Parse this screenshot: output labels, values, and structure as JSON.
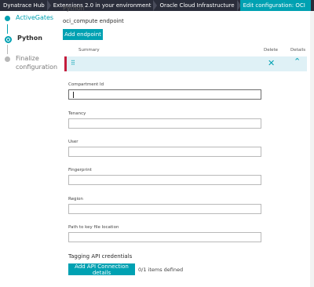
{
  "breadcrumb": [
    {
      "label": "Dynatrace Hub"
    },
    {
      "label": "Extensions 2.0 in your environment"
    },
    {
      "label": "Oracle Cloud Infrastructure"
    },
    {
      "label": "Edit configuration: OCI"
    }
  ],
  "stepper": {
    "steps": [
      {
        "label": "ActiveGates"
      },
      {
        "label": "Python"
      },
      {
        "label": "Finalize configuration"
      }
    ]
  },
  "main": {
    "section_title": "Python",
    "endpoint_title": "oci_compute endpoint",
    "add_endpoint_label": "Add endpoint",
    "columns": {
      "summary": "Summary",
      "delete": "Delete",
      "details": "Details"
    },
    "fields": [
      {
        "label": "Compartment Id",
        "value": ""
      },
      {
        "label": "Tenancy",
        "value": ""
      },
      {
        "label": "User",
        "value": ""
      },
      {
        "label": "Fingerprint",
        "value": ""
      },
      {
        "label": "Region",
        "value": ""
      },
      {
        "label": "Path to key file location",
        "value": ""
      }
    ],
    "tagging_title": "Tagging API credentials",
    "add_api_label": "Add API Connection details",
    "items_defined": "0/1 items defined"
  },
  "colors": {
    "accent": "#00a1b2",
    "alert": "#c41c3c",
    "header": "#2a2d3a"
  },
  "icons": [
    "drag-handle-icon",
    "close-icon",
    "chevron-up-icon"
  ]
}
